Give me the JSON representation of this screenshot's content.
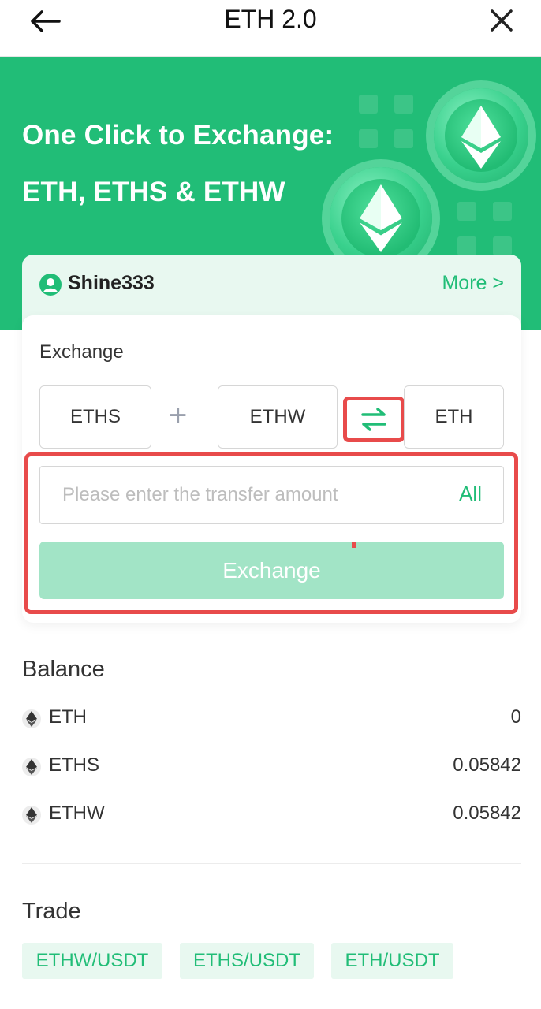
{
  "header": {
    "title": "ETH 2.0",
    "back_icon": "arrow-left-icon",
    "close_icon": "close-icon"
  },
  "hero": {
    "line1": "One Click to Exchange:",
    "line2": "ETH, ETHS & ETHW",
    "accent": "#21bd77"
  },
  "user": {
    "name": "Shine333",
    "more_label": "More >"
  },
  "exchange": {
    "label": "Exchange",
    "from_tokens": [
      "ETHS",
      "ETHW"
    ],
    "plus": "+",
    "to_token": "ETH",
    "swap_icon": "swap-arrows-icon",
    "amount_placeholder": "Please enter the transfer amount",
    "all_label": "All",
    "button_label": "Exchange",
    "highlight_color": "#e84b4b"
  },
  "balance": {
    "title": "Balance",
    "items": [
      {
        "name": "ETH",
        "value": "0"
      },
      {
        "name": "ETHS",
        "value": "0.05842"
      },
      {
        "name": "ETHW",
        "value": "0.05842"
      }
    ]
  },
  "trade": {
    "title": "Trade",
    "pairs": [
      "ETHW/USDT",
      "ETHS/USDT",
      "ETH/USDT"
    ]
  }
}
